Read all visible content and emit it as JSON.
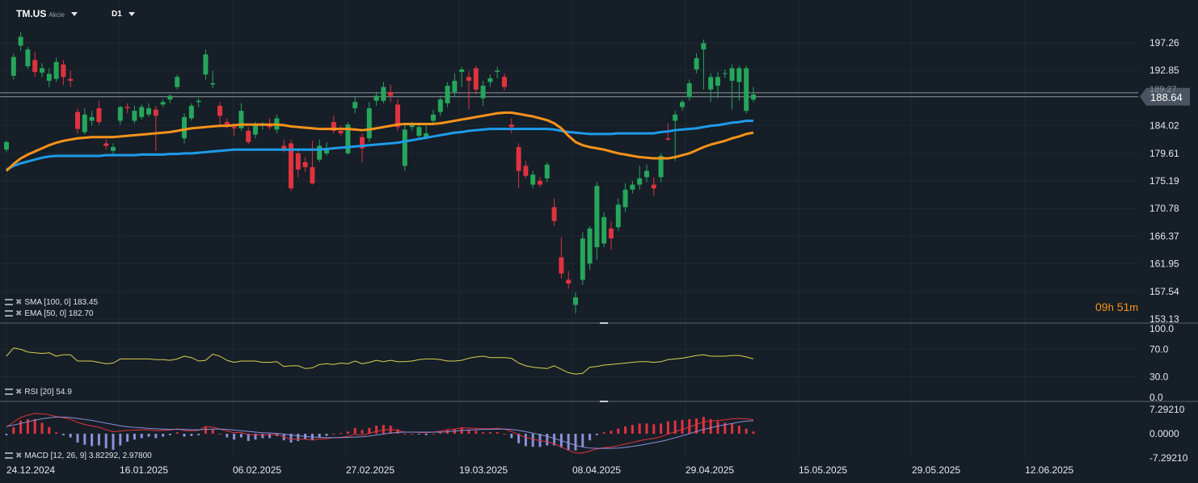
{
  "header": {
    "symbol": "TM.US",
    "instrument_type": "Akcie",
    "interval": "D1"
  },
  "timer": {
    "hours": "09",
    "hours_unit": "h",
    "minutes": "51",
    "minutes_unit": "m"
  },
  "indicators": {
    "sma": {
      "label": "SMA [100, 0]",
      "value": "183.45"
    },
    "ema": {
      "label": "EMA [50, 0]",
      "value": "182.70"
    },
    "rsi": {
      "label": "RSI [20]",
      "value": "54.9"
    },
    "macd": {
      "label": "MACD [12, 26, 9]",
      "value": "3.82292, 2.97800"
    }
  },
  "colors": {
    "background": "#161e27",
    "up": "#26a65b",
    "down": "#e0323f",
    "sma": "#1e9be9",
    "ema": "#f7931a",
    "rsi": "#d8d050",
    "macd": "#e0323f",
    "signal": "#8a90d8",
    "hist_up": "#e0323f",
    "hist_down": "#8a90d8"
  },
  "chart_data": [
    {
      "type": "candlestick",
      "yticks": [
        "197.26",
        "192.85",
        "188.64",
        "184.02",
        "179.61",
        "175.19",
        "170.78",
        "166.37",
        "161.95",
        "157.54",
        "153.13"
      ],
      "current_price": "188.64",
      "prev_price_tag": "189.27",
      "x_dates": [
        "24.12.2024",
        "16.01.2025",
        "06.02.2025",
        "27.02.2025",
        "19.03.2025",
        "08.04.2025",
        "29.04.2025",
        "15.05.2025",
        "29.05.2025",
        "12.06.2025"
      ],
      "candles": [
        [
          180.2,
          181.6,
          179.8,
          181.4
        ],
        [
          192.0,
          195.5,
          191.4,
          195.0
        ],
        [
          196.8,
          199.0,
          196.0,
          198.2
        ],
        [
          193.5,
          196.6,
          193.1,
          196.2
        ],
        [
          194.5,
          195.8,
          191.8,
          192.6
        ],
        [
          192.5,
          194.0,
          191.8,
          193.2
        ],
        [
          191.2,
          193.2,
          190.2,
          192.3
        ],
        [
          191.5,
          194.9,
          191.0,
          194.2
        ],
        [
          193.8,
          194.5,
          190.5,
          191.8
        ],
        [
          191.5,
          192.8,
          190.2,
          191.2
        ],
        [
          186.2,
          186.8,
          182.8,
          183.5
        ],
        [
          183.0,
          186.8,
          182.6,
          185.8
        ],
        [
          184.8,
          186.4,
          184.0,
          185.4
        ],
        [
          186.8,
          188.0,
          184.2,
          184.6
        ],
        [
          181.2,
          181.8,
          180.2,
          180.8
        ],
        [
          180.0,
          181.2,
          179.4,
          180.6
        ],
        [
          184.8,
          187.2,
          184.2,
          187.0
        ],
        [
          187.0,
          187.6,
          186.0,
          186.8
        ],
        [
          184.8,
          187.2,
          184.4,
          186.4
        ],
        [
          185.4,
          187.4,
          185.0,
          187.0
        ],
        [
          185.8,
          187.6,
          185.4,
          186.8
        ],
        [
          186.6,
          187.2,
          180.0,
          185.6
        ],
        [
          187.4,
          188.2,
          187.0,
          187.8
        ],
        [
          188.2,
          189.0,
          187.6,
          188.8
        ],
        [
          190.2,
          192.2,
          189.8,
          191.8
        ],
        [
          182.0,
          186.0,
          181.2,
          185.4
        ],
        [
          185.2,
          187.6,
          184.8,
          187.2
        ],
        [
          187.8,
          188.4,
          187.0,
          188.0
        ],
        [
          192.2,
          196.2,
          191.4,
          195.4
        ],
        [
          190.6,
          192.8,
          190.0,
          190.8
        ],
        [
          187.2,
          187.8,
          183.8,
          185.6
        ],
        [
          184.6,
          185.2,
          183.6,
          184.2
        ],
        [
          183.8,
          184.4,
          182.4,
          183.6
        ],
        [
          183.6,
          187.6,
          183.2,
          186.4
        ],
        [
          183.2,
          183.8,
          181.0,
          181.4
        ],
        [
          182.6,
          184.6,
          182.0,
          184.0
        ],
        [
          184.0,
          184.6,
          183.4,
          184.2
        ],
        [
          184.2,
          185.2,
          183.4,
          183.8
        ],
        [
          183.4,
          185.8,
          182.8,
          185.2
        ],
        [
          180.8,
          181.8,
          179.8,
          180.2
        ],
        [
          181.2,
          181.8,
          173.6,
          174.0
        ],
        [
          179.6,
          180.4,
          175.8,
          177.0
        ],
        [
          178.2,
          179.0,
          176.6,
          177.4
        ],
        [
          177.4,
          181.6,
          174.6,
          174.8
        ],
        [
          178.6,
          181.8,
          178.2,
          180.8
        ],
        [
          179.6,
          181.4,
          179.2,
          180.4
        ],
        [
          184.6,
          185.6,
          182.8,
          183.2
        ],
        [
          183.2,
          184.0,
          182.4,
          182.8
        ],
        [
          179.6,
          184.6,
          179.4,
          184.2
        ],
        [
          186.8,
          188.6,
          186.0,
          187.8
        ],
        [
          182.2,
          182.8,
          178.2,
          180.4
        ],
        [
          182.0,
          187.8,
          181.4,
          186.8
        ],
        [
          188.0,
          189.4,
          187.2,
          188.8
        ],
        [
          188.0,
          191.0,
          187.6,
          190.2
        ],
        [
          189.4,
          190.6,
          187.8,
          188.8
        ],
        [
          187.4,
          188.2,
          183.2,
          183.8
        ],
        [
          177.6,
          184.2,
          176.8,
          183.4
        ],
        [
          183.8,
          184.6,
          183.2,
          184.2
        ],
        [
          182.4,
          184.4,
          181.8,
          183.8
        ],
        [
          182.2,
          184.2,
          181.8,
          182.8
        ],
        [
          184.8,
          186.6,
          184.2,
          185.8
        ],
        [
          186.2,
          188.8,
          185.6,
          188.2
        ],
        [
          187.6,
          191.0,
          187.0,
          190.4
        ],
        [
          189.4,
          192.4,
          188.6,
          191.2
        ],
        [
          192.6,
          193.4,
          190.2,
          193.0
        ],
        [
          191.8,
          192.8,
          186.6,
          191.2
        ],
        [
          193.2,
          193.6,
          189.0,
          189.8
        ],
        [
          188.4,
          191.2,
          187.2,
          190.4
        ],
        [
          191.0,
          192.2,
          190.2,
          191.6
        ],
        [
          192.6,
          193.4,
          191.6,
          192.8
        ],
        [
          191.8,
          192.4,
          189.6,
          190.2
        ],
        [
          184.2,
          185.2,
          182.8,
          183.8
        ],
        [
          180.6,
          181.2,
          174.0,
          176.8
        ],
        [
          177.6,
          178.4,
          175.6,
          176.0
        ],
        [
          174.6,
          176.8,
          174.0,
          176.2
        ],
        [
          175.2,
          175.8,
          174.2,
          174.6
        ],
        [
          175.6,
          178.2,
          175.0,
          177.8
        ],
        [
          171.0,
          172.4,
          168.0,
          168.8
        ],
        [
          163.0,
          166.2,
          159.6,
          160.4
        ],
        [
          159.4,
          160.8,
          158.0,
          158.8
        ],
        [
          155.4,
          157.4,
          154.0,
          156.6
        ],
        [
          159.4,
          167.0,
          158.6,
          166.0
        ],
        [
          162.0,
          168.0,
          161.0,
          167.6
        ],
        [
          164.6,
          175.0,
          162.6,
          174.4
        ],
        [
          165.2,
          170.2,
          164.6,
          169.4
        ],
        [
          167.6,
          168.8,
          164.2,
          166.0
        ],
        [
          167.8,
          172.4,
          167.2,
          171.4
        ],
        [
          171.0,
          174.8,
          170.2,
          173.8
        ],
        [
          173.8,
          175.2,
          173.2,
          174.6
        ],
        [
          174.6,
          177.6,
          173.8,
          175.6
        ],
        [
          175.8,
          177.8,
          175.0,
          176.8
        ],
        [
          174.6,
          175.8,
          172.8,
          174.0
        ],
        [
          175.8,
          179.6,
          175.0,
          179.2
        ],
        [
          182.0,
          184.4,
          181.6,
          181.8
        ],
        [
          184.8,
          186.4,
          178.4,
          185.8
        ],
        [
          187.0,
          188.2,
          186.4,
          187.8
        ],
        [
          188.6,
          191.4,
          188.0,
          190.8
        ],
        [
          193.0,
          195.6,
          192.4,
          194.8
        ],
        [
          196.2,
          197.8,
          189.8,
          197.2
        ],
        [
          189.8,
          192.4,
          187.8,
          191.8
        ],
        [
          190.4,
          192.6,
          188.4,
          191.8
        ],
        [
          192.4,
          193.0,
          191.6,
          192.4
        ],
        [
          191.2,
          193.8,
          186.6,
          193.2
        ],
        [
          191.0,
          193.6,
          188.0,
          193.2
        ],
        [
          186.4,
          193.6,
          186.0,
          193.2
        ],
        [
          188.2,
          190.2,
          187.8,
          189.0
        ]
      ],
      "sma_100": [
        177.0,
        177.6,
        178.0,
        178.3,
        178.6,
        178.9,
        179.1,
        179.2,
        179.2,
        179.2,
        179.2,
        179.2,
        179.2,
        179.2,
        179.3,
        179.3,
        179.3,
        179.3,
        179.3,
        179.4,
        179.4,
        179.4,
        179.4,
        179.5,
        179.5,
        179.6,
        179.6,
        179.7,
        179.8,
        179.9,
        180.0,
        180.1,
        180.2,
        180.2,
        180.2,
        180.2,
        180.2,
        180.2,
        180.2,
        180.2,
        180.2,
        180.2,
        180.2,
        180.2,
        180.2,
        180.3,
        180.4,
        180.5,
        180.6,
        180.7,
        180.8,
        180.9,
        181.0,
        181.1,
        181.2,
        181.3,
        181.5,
        181.7,
        181.9,
        182.1,
        182.3,
        182.5,
        182.7,
        182.9,
        183.0,
        183.2,
        183.3,
        183.4,
        183.5,
        183.5,
        183.5,
        183.5,
        183.5,
        183.5,
        183.5,
        183.5,
        183.5,
        183.4,
        183.2,
        183.0,
        182.9,
        182.8,
        182.7,
        182.7,
        182.7,
        182.7,
        182.8,
        182.8,
        182.8,
        182.8,
        182.8,
        182.8,
        183.0,
        183.1,
        183.3,
        183.4,
        183.5,
        183.6,
        183.8,
        184.0,
        184.1,
        184.3,
        184.5,
        184.6,
        184.8,
        184.8
      ],
      "ema_50": [
        176.8,
        177.9,
        178.8,
        179.4,
        179.9,
        180.4,
        180.9,
        181.3,
        181.6,
        181.8,
        182.0,
        182.1,
        182.2,
        182.2,
        182.2,
        182.2,
        182.3,
        182.4,
        182.5,
        182.6,
        182.7,
        182.8,
        182.9,
        183.0,
        183.2,
        183.4,
        183.6,
        183.7,
        183.8,
        183.9,
        184.0,
        184.0,
        184.1,
        184.2,
        184.2,
        184.2,
        184.2,
        184.2,
        184.2,
        184.1,
        183.9,
        183.8,
        183.7,
        183.6,
        183.5,
        183.5,
        183.5,
        183.5,
        183.5,
        183.4,
        183.3,
        183.4,
        183.6,
        183.8,
        184.0,
        184.2,
        184.3,
        184.3,
        184.3,
        184.3,
        184.3,
        184.4,
        184.6,
        184.8,
        185.0,
        185.2,
        185.4,
        185.6,
        185.8,
        186.0,
        186.1,
        186.1,
        185.9,
        185.7,
        185.5,
        185.2,
        184.9,
        184.4,
        183.6,
        182.4,
        181.4,
        180.9,
        180.6,
        180.4,
        180.2,
        179.9,
        179.6,
        179.4,
        179.2,
        179.0,
        178.9,
        178.8,
        178.8,
        178.8,
        179.0,
        179.3,
        179.6,
        180.1,
        180.6,
        181.0,
        181.3,
        181.6,
        182.0,
        182.3,
        182.7,
        182.9
      ]
    },
    {
      "type": "line",
      "label": "RSI [20]",
      "yticks": [
        "100.0",
        "70.0",
        "30.0",
        "0.0"
      ],
      "ylim": [
        0,
        100
      ],
      "values": [
        60,
        72,
        70,
        66,
        65,
        64,
        65,
        60,
        62,
        62,
        53,
        53,
        53,
        51,
        49,
        50,
        56,
        56,
        56,
        56,
        56,
        55,
        55,
        54,
        56,
        60,
        58,
        53,
        54,
        63,
        60,
        54,
        51,
        53,
        53,
        53,
        51,
        51,
        52,
        45,
        46,
        46,
        42,
        43,
        48,
        49,
        48,
        50,
        49,
        53,
        49,
        51,
        54,
        52,
        54,
        52,
        52,
        53,
        55,
        56,
        56,
        55,
        53,
        53,
        54,
        57,
        59,
        60,
        58,
        58,
        58,
        57,
        50,
        46,
        44,
        43,
        42,
        46,
        41,
        36,
        34,
        35,
        44,
        45,
        47,
        48,
        49,
        50,
        51,
        52,
        52,
        51,
        52,
        55,
        56,
        57,
        59,
        61,
        62,
        60,
        60,
        60,
        61,
        61,
        59,
        56
      ]
    },
    {
      "type": "macd",
      "label": "MACD [12, 26, 9]",
      "yticks": [
        "7.29210",
        "0.0000",
        "-7.29210"
      ],
      "ylim": [
        -7.2921,
        7.2921
      ],
      "macd": [
        2.0,
        3.5,
        4.9,
        5.6,
        6.1,
        6.0,
        5.7,
        5.2,
        4.8,
        4.4,
        3.4,
        2.8,
        2.3,
        2.0,
        1.2,
        0.6,
        0.8,
        1.0,
        1.1,
        1.2,
        1.2,
        0.9,
        1.0,
        1.1,
        1.5,
        0.9,
        0.9,
        1.0,
        2.2,
        2.0,
        1.4,
        0.8,
        0.3,
        0.4,
        -0.3,
        -0.3,
        -0.3,
        -0.4,
        -0.2,
        -1.0,
        -1.6,
        -1.6,
        -1.6,
        -1.9,
        -1.6,
        -1.5,
        -1.2,
        -1.1,
        -0.8,
        -0.2,
        -0.4,
        0.1,
        0.7,
        1.1,
        1.3,
        1.0,
        0.5,
        0.5,
        0.4,
        0.3,
        0.5,
        0.8,
        1.2,
        1.4,
        1.8,
        1.7,
        1.6,
        1.5,
        1.5,
        1.6,
        1.4,
        0.7,
        -0.3,
        -1.1,
        -1.6,
        -2.1,
        -2.4,
        -3.0,
        -4.0,
        -5.0,
        -5.8,
        -5.8,
        -5.2,
        -4.6,
        -4.2,
        -4.0,
        -3.6,
        -3.1,
        -2.6,
        -2.1,
        -1.7,
        -1.4,
        -0.9,
        -0.1,
        0.6,
        1.3,
        2.0,
        2.8,
        3.6,
        3.8,
        4.0,
        4.2,
        4.5,
        4.6,
        4.5,
        4.2
      ],
      "signal": [
        2.2,
        2.6,
        3.1,
        3.6,
        4.1,
        4.5,
        4.8,
        5.0,
        5.0,
        4.9,
        4.6,
        4.3,
        4.0,
        3.6,
        3.2,
        2.8,
        2.4,
        2.1,
        1.9,
        1.8,
        1.6,
        1.5,
        1.4,
        1.3,
        1.3,
        1.3,
        1.2,
        1.2,
        1.3,
        1.4,
        1.4,
        1.3,
        1.1,
        0.9,
        0.7,
        0.5,
        0.3,
        0.2,
        0.1,
        -0.1,
        -0.4,
        -0.6,
        -0.8,
        -1.0,
        -1.1,
        -1.2,
        -1.2,
        -1.2,
        -1.1,
        -1.0,
        -0.9,
        -0.7,
        -0.4,
        -0.1,
        0.2,
        0.4,
        0.5,
        0.5,
        0.5,
        0.5,
        0.5,
        0.5,
        0.6,
        0.8,
        1.0,
        1.1,
        1.2,
        1.3,
        1.3,
        1.4,
        1.4,
        1.3,
        1.0,
        0.6,
        0.2,
        -0.3,
        -0.8,
        -1.4,
        -2.1,
        -2.8,
        -3.5,
        -4.0,
        -4.3,
        -4.4,
        -4.4,
        -4.4,
        -4.3,
        -4.1,
        -3.8,
        -3.5,
        -3.1,
        -2.7,
        -2.3,
        -1.8,
        -1.2,
        -0.6,
        0.0,
        0.7,
        1.3,
        1.8,
        2.3,
        2.7,
        3.1,
        3.5,
        3.8,
        3.9
      ]
    }
  ]
}
